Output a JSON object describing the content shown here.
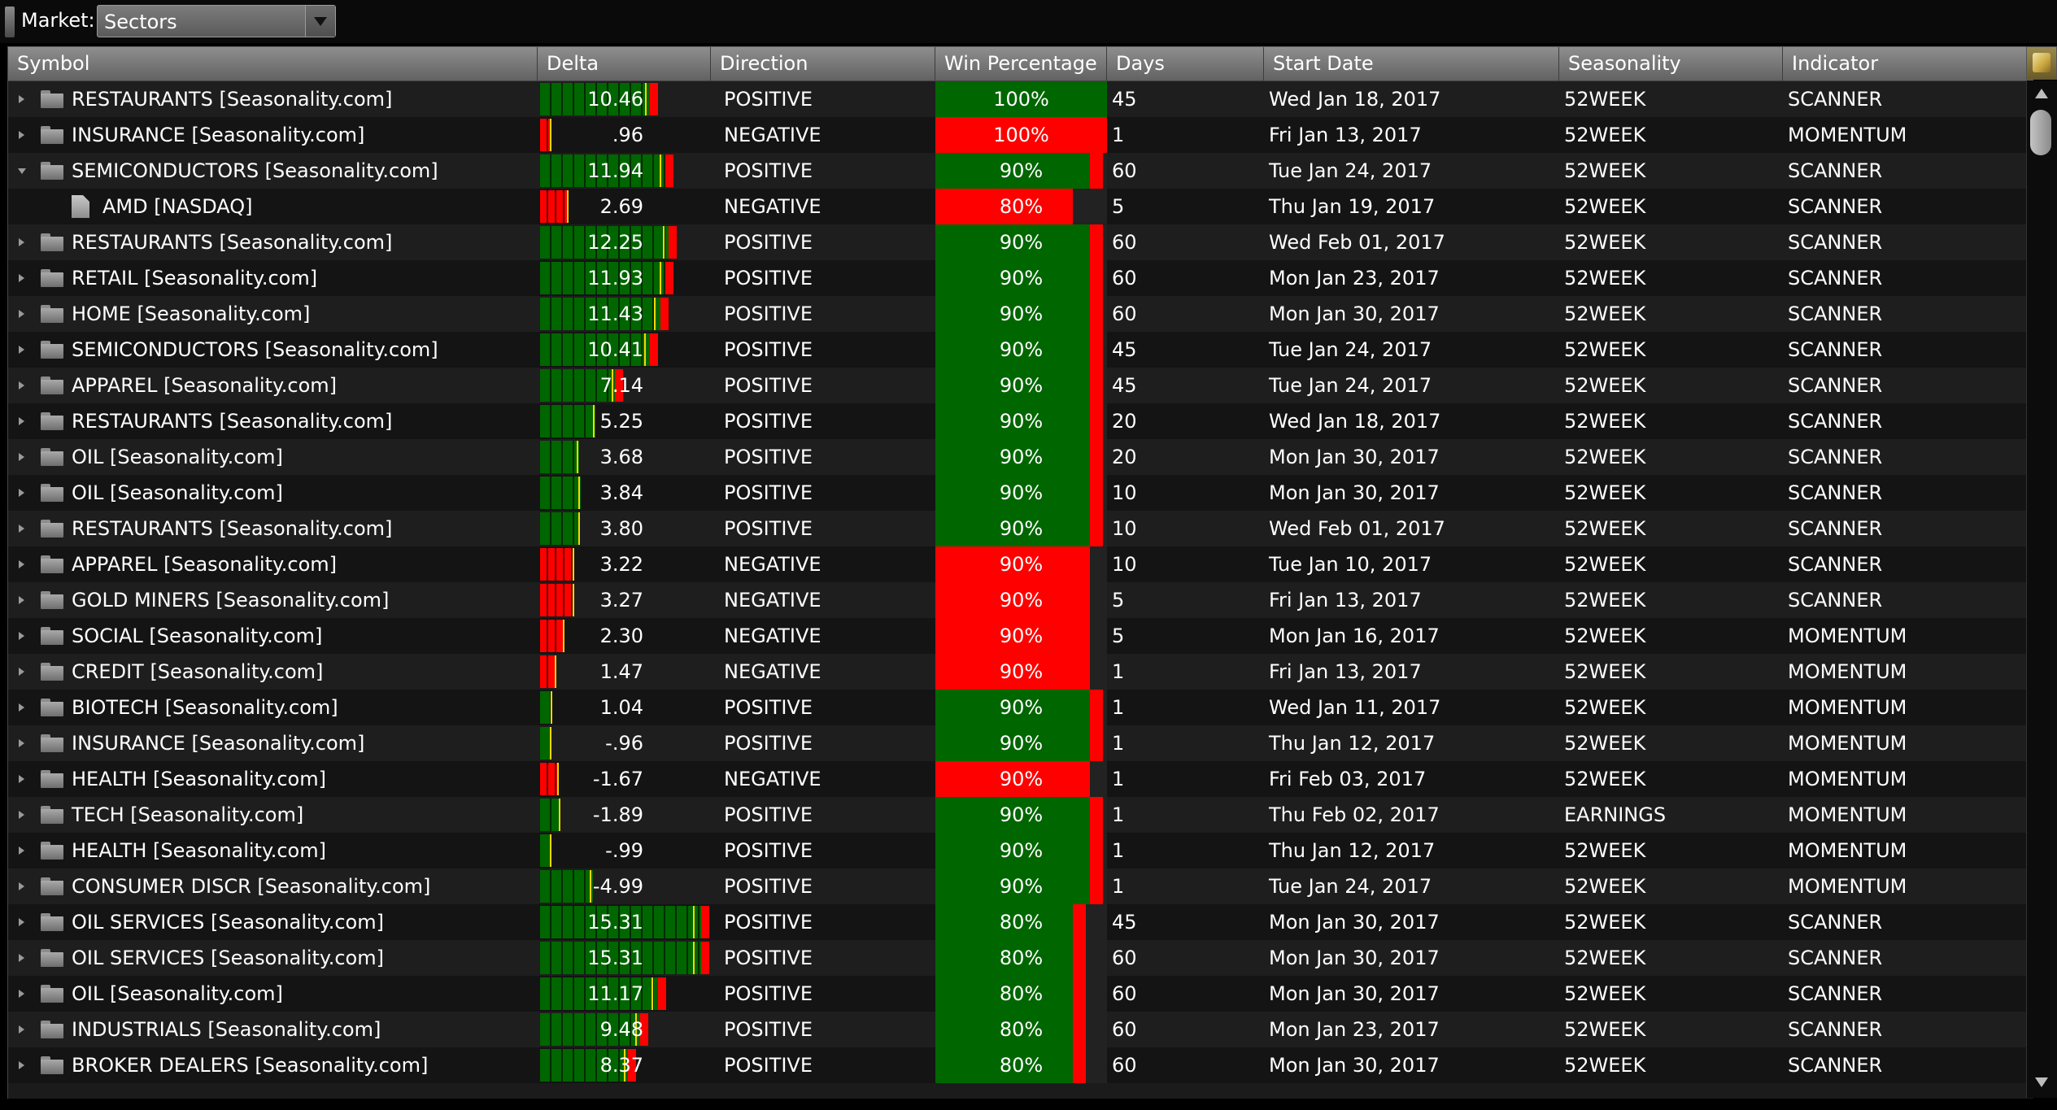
{
  "market": {
    "label": "Market:",
    "value": "Sectors"
  },
  "columns": [
    "Symbol",
    "Delta",
    "Direction",
    "Win Percentage",
    "Days",
    "Start Date",
    "Seasonality",
    "Indicator"
  ],
  "colors": {
    "positive": "#006600",
    "negative": "#ff0000",
    "marker": "#f4d800",
    "win_gap": "#ff0000"
  },
  "rows": [
    {
      "symbol": "RESTAURANTS [Seasonality.com]",
      "type": "folder",
      "expanded": false,
      "delta": "10.46",
      "direction": "POSITIVE",
      "win": "100%",
      "win_frac": 1.0,
      "days": "45",
      "start_date": "Wed Jan 18, 2017",
      "seasonality": "52WEEK",
      "indicator": "SCANNER"
    },
    {
      "symbol": "INSURANCE [Seasonality.com]",
      "type": "folder",
      "expanded": false,
      "delta": ".96",
      "direction": "NEGATIVE",
      "win": "100%",
      "win_frac": 1.0,
      "days": "1",
      "start_date": "Fri Jan 13, 2017",
      "seasonality": "52WEEK",
      "indicator": "MOMENTUM"
    },
    {
      "symbol": "SEMICONDUCTORS [Seasonality.com]",
      "type": "folder",
      "expanded": true,
      "delta": "11.94",
      "direction": "POSITIVE",
      "win": "90%",
      "win_frac": 0.9,
      "days": "60",
      "start_date": "Tue Jan 24, 2017",
      "seasonality": "52WEEK",
      "indicator": "SCANNER"
    },
    {
      "symbol": "AMD [NASDAQ]",
      "type": "file",
      "expanded": false,
      "delta": "2.69",
      "direction": "NEGATIVE",
      "win": "80%",
      "win_frac": 0.8,
      "days": "5",
      "start_date": "Thu Jan 19, 2017",
      "seasonality": "52WEEK",
      "indicator": "SCANNER"
    },
    {
      "symbol": "RESTAURANTS [Seasonality.com]",
      "type": "folder",
      "expanded": false,
      "delta": "12.25",
      "direction": "POSITIVE",
      "win": "90%",
      "win_frac": 0.9,
      "days": "60",
      "start_date": "Wed Feb 01, 2017",
      "seasonality": "52WEEK",
      "indicator": "SCANNER"
    },
    {
      "symbol": "RETAIL [Seasonality.com]",
      "type": "folder",
      "expanded": false,
      "delta": "11.93",
      "direction": "POSITIVE",
      "win": "90%",
      "win_frac": 0.9,
      "days": "60",
      "start_date": "Mon Jan 23, 2017",
      "seasonality": "52WEEK",
      "indicator": "SCANNER"
    },
    {
      "symbol": "HOME [Seasonality.com]",
      "type": "folder",
      "expanded": false,
      "delta": "11.43",
      "direction": "POSITIVE",
      "win": "90%",
      "win_frac": 0.9,
      "days": "60",
      "start_date": "Mon Jan 30, 2017",
      "seasonality": "52WEEK",
      "indicator": "SCANNER"
    },
    {
      "symbol": "SEMICONDUCTORS [Seasonality.com]",
      "type": "folder",
      "expanded": false,
      "delta": "10.41",
      "direction": "POSITIVE",
      "win": "90%",
      "win_frac": 0.9,
      "days": "45",
      "start_date": "Tue Jan 24, 2017",
      "seasonality": "52WEEK",
      "indicator": "SCANNER"
    },
    {
      "symbol": "APPAREL [Seasonality.com]",
      "type": "folder",
      "expanded": false,
      "delta": "7.14",
      "direction": "POSITIVE",
      "win": "90%",
      "win_frac": 0.9,
      "days": "45",
      "start_date": "Tue Jan 24, 2017",
      "seasonality": "52WEEK",
      "indicator": "SCANNER"
    },
    {
      "symbol": "RESTAURANTS [Seasonality.com]",
      "type": "folder",
      "expanded": false,
      "delta": "5.25",
      "direction": "POSITIVE",
      "win": "90%",
      "win_frac": 0.9,
      "days": "20",
      "start_date": "Wed Jan 18, 2017",
      "seasonality": "52WEEK",
      "indicator": "SCANNER"
    },
    {
      "symbol": "OIL [Seasonality.com]",
      "type": "folder",
      "expanded": false,
      "delta": "3.68",
      "direction": "POSITIVE",
      "win": "90%",
      "win_frac": 0.9,
      "days": "20",
      "start_date": "Mon Jan 30, 2017",
      "seasonality": "52WEEK",
      "indicator": "SCANNER"
    },
    {
      "symbol": "OIL [Seasonality.com]",
      "type": "folder",
      "expanded": false,
      "delta": "3.84",
      "direction": "POSITIVE",
      "win": "90%",
      "win_frac": 0.9,
      "days": "10",
      "start_date": "Mon Jan 30, 2017",
      "seasonality": "52WEEK",
      "indicator": "SCANNER"
    },
    {
      "symbol": "RESTAURANTS [Seasonality.com]",
      "type": "folder",
      "expanded": false,
      "delta": "3.80",
      "direction": "POSITIVE",
      "win": "90%",
      "win_frac": 0.9,
      "days": "10",
      "start_date": "Wed Feb 01, 2017",
      "seasonality": "52WEEK",
      "indicator": "SCANNER"
    },
    {
      "symbol": "APPAREL [Seasonality.com]",
      "type": "folder",
      "expanded": false,
      "delta": "3.22",
      "direction": "NEGATIVE",
      "win": "90%",
      "win_frac": 0.9,
      "days": "10",
      "start_date": "Tue Jan 10, 2017",
      "seasonality": "52WEEK",
      "indicator": "SCANNER"
    },
    {
      "symbol": "GOLD MINERS [Seasonality.com]",
      "type": "folder",
      "expanded": false,
      "delta": "3.27",
      "direction": "NEGATIVE",
      "win": "90%",
      "win_frac": 0.9,
      "days": "5",
      "start_date": "Fri Jan 13, 2017",
      "seasonality": "52WEEK",
      "indicator": "SCANNER"
    },
    {
      "symbol": "SOCIAL [Seasonality.com]",
      "type": "folder",
      "expanded": false,
      "delta": "2.30",
      "direction": "NEGATIVE",
      "win": "90%",
      "win_frac": 0.9,
      "days": "5",
      "start_date": "Mon Jan 16, 2017",
      "seasonality": "52WEEK",
      "indicator": "MOMENTUM"
    },
    {
      "symbol": "CREDIT [Seasonality.com]",
      "type": "folder",
      "expanded": false,
      "delta": "1.47",
      "direction": "NEGATIVE",
      "win": "90%",
      "win_frac": 0.9,
      "days": "1",
      "start_date": "Fri Jan 13, 2017",
      "seasonality": "52WEEK",
      "indicator": "MOMENTUM"
    },
    {
      "symbol": "BIOTECH [Seasonality.com]",
      "type": "folder",
      "expanded": false,
      "delta": "1.04",
      "direction": "POSITIVE",
      "win": "90%",
      "win_frac": 0.9,
      "days": "1",
      "start_date": "Wed Jan 11, 2017",
      "seasonality": "52WEEK",
      "indicator": "MOMENTUM"
    },
    {
      "symbol": "INSURANCE [Seasonality.com]",
      "type": "folder",
      "expanded": false,
      "delta": "-.96",
      "direction": "POSITIVE",
      "win": "90%",
      "win_frac": 0.9,
      "days": "1",
      "start_date": "Thu Jan 12, 2017",
      "seasonality": "52WEEK",
      "indicator": "MOMENTUM"
    },
    {
      "symbol": "HEALTH [Seasonality.com]",
      "type": "folder",
      "expanded": false,
      "delta": "-1.67",
      "direction": "NEGATIVE",
      "win": "90%",
      "win_frac": 0.9,
      "days": "1",
      "start_date": "Fri Feb 03, 2017",
      "seasonality": "52WEEK",
      "indicator": "MOMENTUM"
    },
    {
      "symbol": "TECH [Seasonality.com]",
      "type": "folder",
      "expanded": false,
      "delta": "-1.89",
      "direction": "POSITIVE",
      "win": "90%",
      "win_frac": 0.9,
      "days": "1",
      "start_date": "Thu Feb 02, 2017",
      "seasonality": "EARNINGS",
      "indicator": "MOMENTUM"
    },
    {
      "symbol": "HEALTH [Seasonality.com]",
      "type": "folder",
      "expanded": false,
      "delta": "-.99",
      "direction": "POSITIVE",
      "win": "90%",
      "win_frac": 0.9,
      "days": "1",
      "start_date": "Thu Jan 12, 2017",
      "seasonality": "52WEEK",
      "indicator": "MOMENTUM"
    },
    {
      "symbol": "CONSUMER DISCR [Seasonality.com]",
      "type": "folder",
      "expanded": false,
      "delta": "-4.99",
      "direction": "POSITIVE",
      "win": "90%",
      "win_frac": 0.9,
      "days": "1",
      "start_date": "Tue Jan 24, 2017",
      "seasonality": "52WEEK",
      "indicator": "MOMENTUM"
    },
    {
      "symbol": "OIL SERVICES [Seasonality.com]",
      "type": "folder",
      "expanded": false,
      "delta": "15.31",
      "direction": "POSITIVE",
      "win": "80%",
      "win_frac": 0.8,
      "days": "45",
      "start_date": "Mon Jan 30, 2017",
      "seasonality": "52WEEK",
      "indicator": "SCANNER"
    },
    {
      "symbol": "OIL SERVICES [Seasonality.com]",
      "type": "folder",
      "expanded": false,
      "delta": "15.31",
      "direction": "POSITIVE",
      "win": "80%",
      "win_frac": 0.8,
      "days": "60",
      "start_date": "Mon Jan 30, 2017",
      "seasonality": "52WEEK",
      "indicator": "SCANNER"
    },
    {
      "symbol": "OIL [Seasonality.com]",
      "type": "folder",
      "expanded": false,
      "delta": "11.17",
      "direction": "POSITIVE",
      "win": "80%",
      "win_frac": 0.8,
      "days": "60",
      "start_date": "Mon Jan 30, 2017",
      "seasonality": "52WEEK",
      "indicator": "SCANNER"
    },
    {
      "symbol": "INDUSTRIALS [Seasonality.com]",
      "type": "folder",
      "expanded": false,
      "delta": "9.48",
      "direction": "POSITIVE",
      "win": "80%",
      "win_frac": 0.8,
      "days": "60",
      "start_date": "Mon Jan 23, 2017",
      "seasonality": "52WEEK",
      "indicator": "SCANNER"
    },
    {
      "symbol": "BROKER DEALERS [Seasonality.com]",
      "type": "folder",
      "expanded": false,
      "delta": "8.37",
      "direction": "POSITIVE",
      "win": "80%",
      "win_frac": 0.8,
      "days": "60",
      "start_date": "Mon Jan 30, 2017",
      "seasonality": "52WEEK",
      "indicator": "SCANNER"
    }
  ]
}
